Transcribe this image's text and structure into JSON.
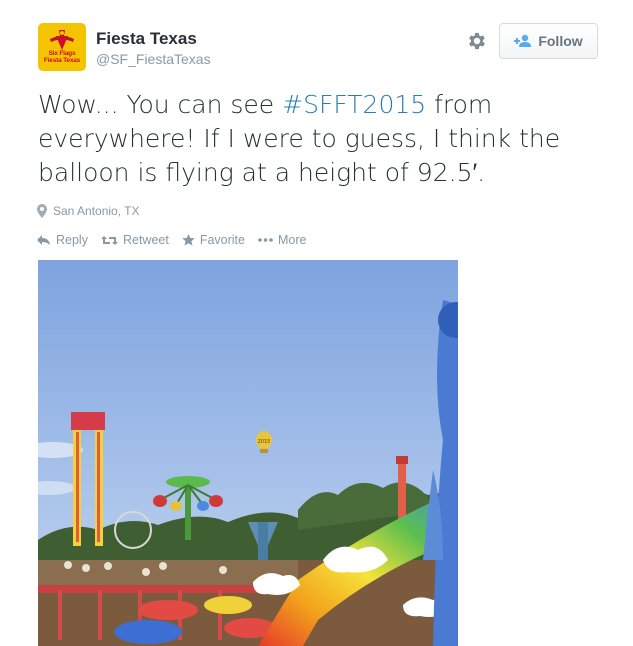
{
  "user": {
    "name": "Fiesta Texas",
    "handle": "@SF_FiestaTexas",
    "avatar_text_line1": "Six Flags",
    "avatar_text_line2": "Fiesta Texas"
  },
  "header": {
    "follow_label": "Follow",
    "settings_icon": "gear-icon",
    "follow_icon": "add-user-icon"
  },
  "tweet": {
    "text_before": "Wow... You can see ",
    "hashtag": "#SFFT2015",
    "text_after": " from everywhere! If I were to guess, I think the balloon is flying at a height of 92.5′.",
    "location": "San Antonio, TX",
    "balloon_label": "2015"
  },
  "actions": {
    "reply": "Reply",
    "retweet": "Retweet",
    "favorite": "Favorite",
    "more": "More"
  },
  "colors": {
    "hashtag": "#2b7bb9",
    "muted": "#8899a6",
    "text": "#292f33",
    "avatar_bg": "#f5c400"
  }
}
